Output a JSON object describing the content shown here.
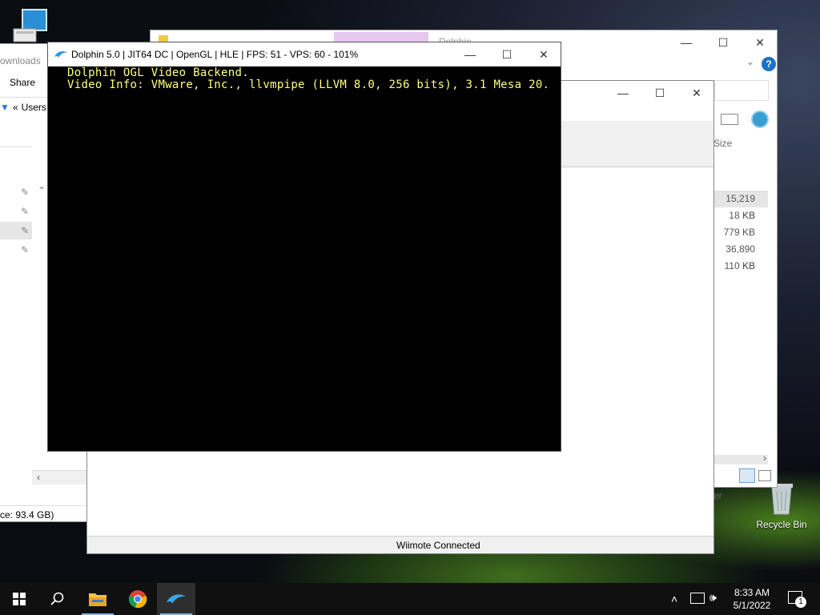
{
  "desktop": {
    "this_pc_icon": "computer-icon",
    "recycle_bin_label": "Recycle Bin"
  },
  "explorer_left": {
    "ribbon_tab": "ownloads",
    "share_tab": "Share",
    "path_label": "Users",
    "status_text": "ce: 93.4 GB)"
  },
  "explorer_right": {
    "tab_partial": "Dolphin",
    "size_header": "Size",
    "sizes": [
      "15,219 KB",
      "18 KB",
      "779 KB",
      "36,890 KB",
      "110 KB"
    ],
    "partial_label": "er"
  },
  "dolphin_main": {
    "status_bar": "Wiimote Connected"
  },
  "render_window": {
    "title": "Dolphin 5.0 | JIT64 DC | OpenGL | HLE | FPS: 51 - VPS: 60 - 101%",
    "line1": "Dolphin OGL Video Backend.",
    "line2": "Video Info: VMware, Inc., llvmpipe (LLVM 8.0, 256 bits), 3.1 Mesa 20.",
    "text_color": "#ffff80"
  },
  "taskbar": {
    "time": "8:33 AM",
    "date": "5/1/2022",
    "notification_count": "1"
  }
}
